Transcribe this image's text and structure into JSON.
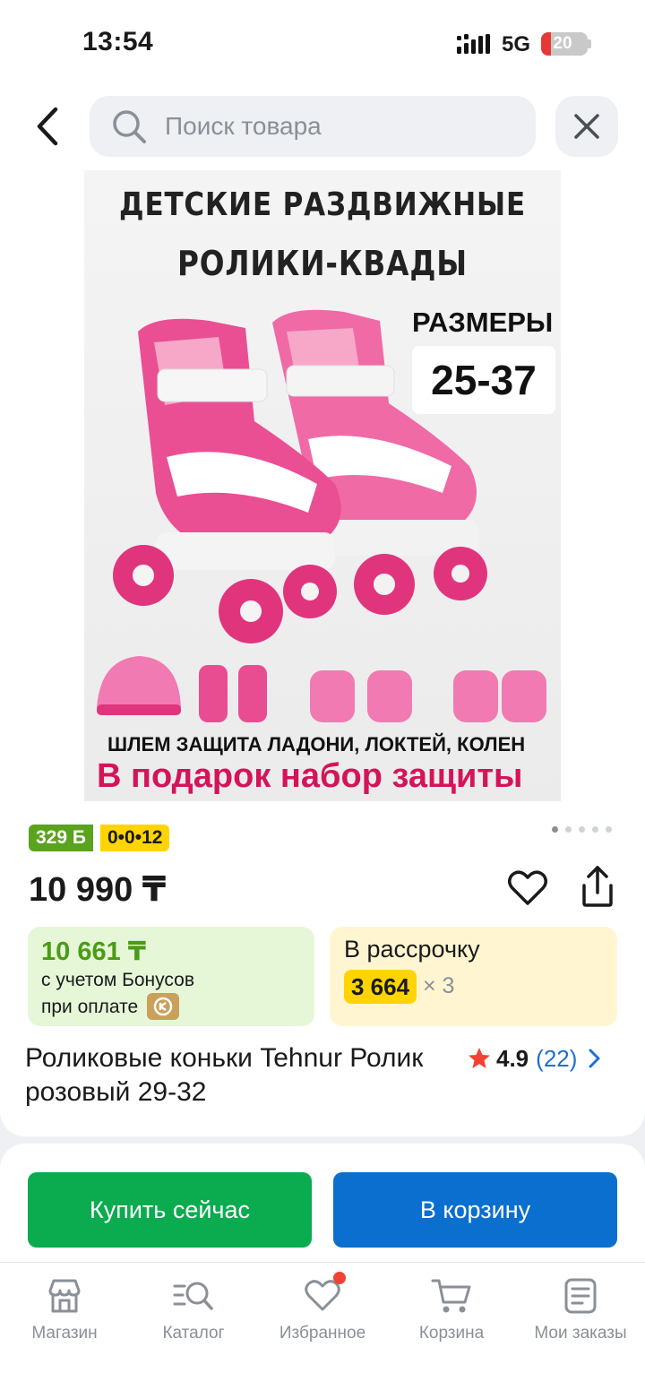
{
  "status_bar": {
    "time": "13:54",
    "network": "5G",
    "battery": "20",
    "battery_level_percent": 20
  },
  "search": {
    "placeholder": "Поиск товара"
  },
  "product_image": {
    "headline_1": "ДЕТСКИЕ РАЗДВИЖНЫЕ",
    "headline_2": "РОЛИКИ-КВАДЫ",
    "sizes_label": "РАЗМЕРЫ",
    "sizes_value": "25-37",
    "caption": "ШЛЕМ  ЗАЩИТА ЛАДОНИ, ЛОКТЕЙ, КОЛЕН",
    "gift": "В подарок набор защиты"
  },
  "gallery": {
    "total_images": 5,
    "active_index": 0
  },
  "badges": {
    "bonus": "329 Б",
    "installment_plan": "0•0•12"
  },
  "price": "10 990 ₸",
  "offers": {
    "bonus": {
      "amount": "10 661 ₸",
      "line1": "с учетом Бонусов",
      "line2": "при оплате"
    },
    "installment": {
      "title": "В рассрочку",
      "monthly": "3 664",
      "multiplier": "× 3"
    }
  },
  "product": {
    "title": "Роликовые коньки Tehnur Ролик розовый 29-32",
    "rating": "4.9",
    "reviews": "(22)"
  },
  "actions": {
    "buy_now": "Купить сейчас",
    "add_to_cart": "В корзину"
  },
  "tabbar": [
    {
      "label": "Магазин",
      "icon": "shop-icon"
    },
    {
      "label": "Каталог",
      "icon": "catalog-icon"
    },
    {
      "label": "Избранное",
      "icon": "heart-icon",
      "has_dot": true
    },
    {
      "label": "Корзина",
      "icon": "cart-icon"
    },
    {
      "label": "Мои заказы",
      "icon": "orders-icon"
    }
  ],
  "colors": {
    "primary_blue": "#0a6fcf",
    "buy_green": "#0bab4f",
    "bonus_green": "#5aa31c",
    "plan_yellow": "#ffd400",
    "product_pink": "#e63d8a"
  }
}
